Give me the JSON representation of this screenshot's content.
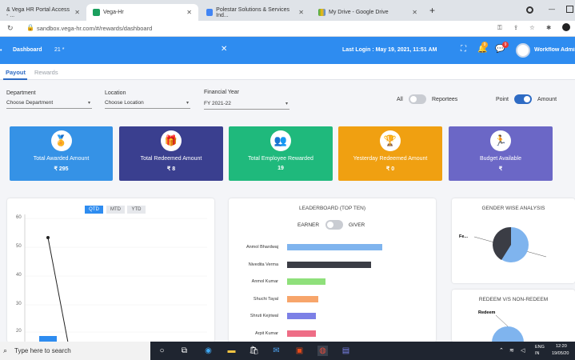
{
  "browser": {
    "tabs": [
      {
        "title": "& Vega HR Portal Access - ...",
        "active": false
      },
      {
        "title": "Vega-Hr",
        "active": true
      },
      {
        "title": "Polestar Solutions & Services Ind...",
        "active": false
      },
      {
        "title": "My Drive - Google Drive",
        "active": false
      }
    ],
    "new_tab": "+",
    "address": "sandbox.vega-hr.com/#/rewards/dashboard"
  },
  "appbar": {
    "title": "Dashboard",
    "sub": "21 *",
    "last_login": "Last Login : May 19, 2021, 11:51 AM",
    "notif_badge_1": "9",
    "notif_badge_2": "9",
    "user_name": "Workflow Admin"
  },
  "subtabs": [
    "Payout",
    "Rewards"
  ],
  "filters": {
    "department_label": "Department",
    "department_value": "Choose Department",
    "location_label": "Location",
    "location_value": "Choose Location",
    "fy_label": "Financial Year",
    "fy_value": "FY 2021-22",
    "all_label": "All",
    "reportees_label": "Reportees",
    "point_label": "Point",
    "amount_label": "Amount"
  },
  "kpis": [
    {
      "title": "Total Awarded Amount",
      "value": "₹ 295",
      "color": "#3592e6",
      "icon": "award-icon"
    },
    {
      "title": "Total Redeemed Amount",
      "value": "₹ 8",
      "color": "#3a3f8f",
      "icon": "gift-icon"
    },
    {
      "title": "Total Employee Rewarded",
      "value": "19",
      "color": "#1fb97c",
      "icon": "team-icon"
    },
    {
      "title": "Yesterday Redeemed Amount",
      "value": "₹ 0",
      "color": "#f0a011",
      "icon": "podium-icon"
    },
    {
      "title": "Budget Available",
      "value": "₹",
      "color": "#6b67c6",
      "icon": "runner-icon"
    }
  ],
  "trend": {
    "segments": [
      "QTD",
      "MTD",
      "YTD"
    ],
    "y_ticks": [
      "60",
      "50",
      "40",
      "30",
      "20"
    ]
  },
  "leaderboard": {
    "title": "LEADERBOARD (TOP TEN)",
    "earner_label": "EARNER",
    "giver_label": "GIVER",
    "chart_data": {
      "type": "bar",
      "orientation": "horizontal",
      "categories": [
        "Anmol Bhardwaj",
        "Nivedita Verma",
        "Anmol Kumar",
        "Shuchi Tayal",
        "Shruti Kejriwal",
        "Arpit Kumar"
      ],
      "values": [
        100,
        88,
        40,
        33,
        30,
        30
      ],
      "colors": [
        "#7fb4ee",
        "#3b3d45",
        "#8fe07b",
        "#f7a56b",
        "#7c80e6",
        "#ee6d86"
      ]
    }
  },
  "gender": {
    "title": "GENDER WISE ANALYSIS",
    "label": "Fe..."
  },
  "redeem": {
    "title": "REDEEM V/S NON-REDEEM",
    "label": "Redeem"
  },
  "taskbar": {
    "search_placeholder": "Type here to search",
    "lang": "ENG\nIN",
    "time": "12:20",
    "date": "19/05/20"
  }
}
